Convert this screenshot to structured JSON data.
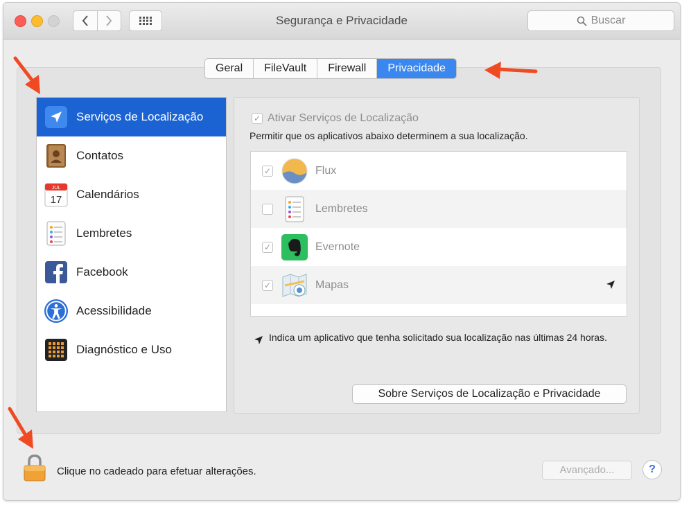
{
  "window": {
    "title": "Segurança e Privacidade"
  },
  "toolbar": {
    "search_placeholder": "Buscar"
  },
  "tabs": [
    {
      "label": "Geral"
    },
    {
      "label": "FileVault"
    },
    {
      "label": "Firewall"
    },
    {
      "label": "Privacidade",
      "active": true
    }
  ],
  "sidebar": {
    "items": [
      {
        "label": "Serviços de Localização",
        "icon": "location-arrow-icon",
        "selected": true
      },
      {
        "label": "Contatos",
        "icon": "contacts-icon"
      },
      {
        "label": "Calendários",
        "icon": "calendar-icon",
        "icon_text_month": "JUL",
        "icon_text_day": "17"
      },
      {
        "label": "Lembretes",
        "icon": "reminders-icon"
      },
      {
        "label": "Facebook",
        "icon": "facebook-icon"
      },
      {
        "label": "Acessibilidade",
        "icon": "accessibility-icon"
      },
      {
        "label": "Diagnóstico e Uso",
        "icon": "diagnostics-icon"
      }
    ]
  },
  "location": {
    "enable_label": "Ativar Serviços de Localização",
    "enabled": true,
    "description": "Permitir que os aplicativos abaixo determinem a sua localização.",
    "apps": [
      {
        "name": "Flux",
        "checked": true,
        "icon": "flux-icon"
      },
      {
        "name": "Lembretes",
        "checked": false,
        "icon": "reminders-icon"
      },
      {
        "name": "Evernote",
        "checked": true,
        "icon": "evernote-icon"
      },
      {
        "name": "Mapas",
        "checked": true,
        "icon": "maps-icon",
        "recent_location": true
      }
    ],
    "note": "Indica um aplicativo que tenha solicitado sua localização nas últimas 24 horas.",
    "about_button": "Sobre Serviços de Localização e Privacidade"
  },
  "footer": {
    "lock_text": "Clique no cadeado para efetuar alterações.",
    "advanced_button": "Avançado...",
    "help_button": "?"
  },
  "colors": {
    "accent": "#1b63d2",
    "tab_active": "#3a87f0",
    "annotation": "#f04a23"
  }
}
